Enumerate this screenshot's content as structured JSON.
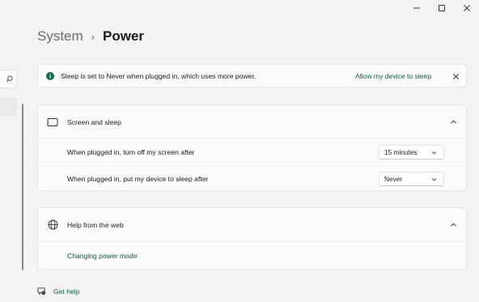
{
  "window": {
    "controls": [
      {
        "name": "minimize",
        "icon": "minimize-icon"
      },
      {
        "name": "maximize",
        "icon": "maximize-icon"
      },
      {
        "name": "close",
        "icon": "close-icon"
      }
    ]
  },
  "nav": {
    "search_icon": "search-icon"
  },
  "breadcrumb": {
    "parent": "System",
    "separator": "›",
    "current": "Power"
  },
  "info_bar": {
    "icon": "info-icon",
    "text": "Sleep is set to Never when plugged in, which uses more power.",
    "link": "Allow my device to sleep",
    "close_icon": "close-icon"
  },
  "screen_sleep": {
    "icon": "screen-sleep-icon",
    "title": "Screen and sleep",
    "expanded": true,
    "rows": [
      {
        "label": "When plugged in, turn off my screen after",
        "value": "15 minutes"
      },
      {
        "label": "When plugged in, put my device to sleep after",
        "value": "Never"
      }
    ]
  },
  "help_web": {
    "icon": "globe-icon",
    "title": "Help from the web",
    "expanded": true,
    "link": "Changing power mode"
  },
  "footer": {
    "icon": "get-help-icon",
    "get_help": "Get help"
  },
  "colors": {
    "background": "#f3f3f3",
    "card": "#fbfbfb",
    "accent_link": "#0a5a47",
    "info_icon": "#0f6e52"
  }
}
